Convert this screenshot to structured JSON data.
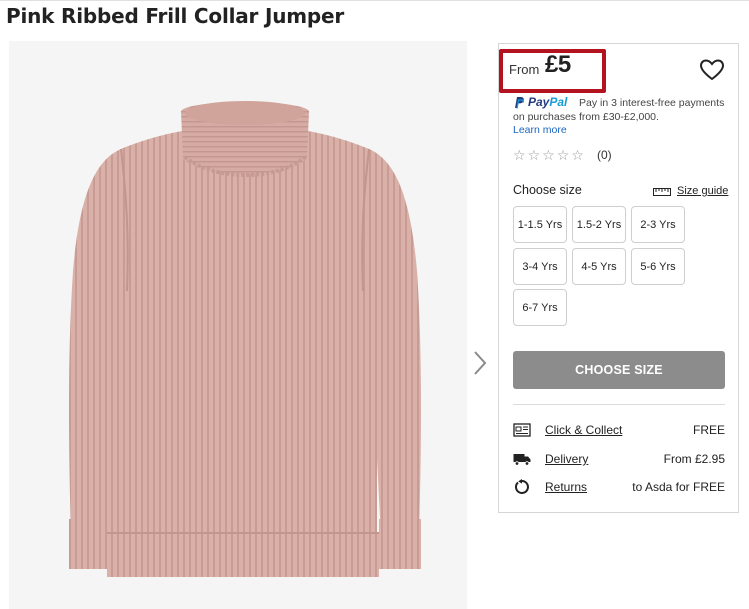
{
  "product": {
    "title": "Pink Ribbed Frill Collar Jumper",
    "image_alt": "pink-ribbed-jumper-photo"
  },
  "price": {
    "from_label": "From",
    "value": "£5"
  },
  "paypal": {
    "logo_pay": "Pay",
    "logo_pal": "Pal",
    "text": "Pay in 3 interest-free payments on purchases from £30-£2,000.",
    "learn_more": "Learn more"
  },
  "reviews": {
    "rating": 0,
    "max": 5,
    "count_label": "(0)"
  },
  "size": {
    "label": "Choose size",
    "guide_label": "Size guide",
    "options": [
      "1-1.5 Yrs",
      "1.5-2 Yrs",
      "2-3 Yrs",
      "3-4 Yrs",
      "4-5 Yrs",
      "5-6 Yrs",
      "6-7 Yrs"
    ]
  },
  "cta": {
    "label": "CHOOSE SIZE"
  },
  "delivery": [
    {
      "icon": "store-icon",
      "label": "Click & Collect",
      "value": "FREE"
    },
    {
      "icon": "truck-icon",
      "label": "Delivery",
      "value": "From £2.95"
    },
    {
      "icon": "returns-icon",
      "label": "Returns",
      "value": "to Asda for FREE"
    }
  ],
  "colors": {
    "highlight_border": "#b3121f",
    "cta_bg": "#8c8c8c",
    "link_blue": "#1a66c2",
    "sweater": "#d6aba3"
  }
}
